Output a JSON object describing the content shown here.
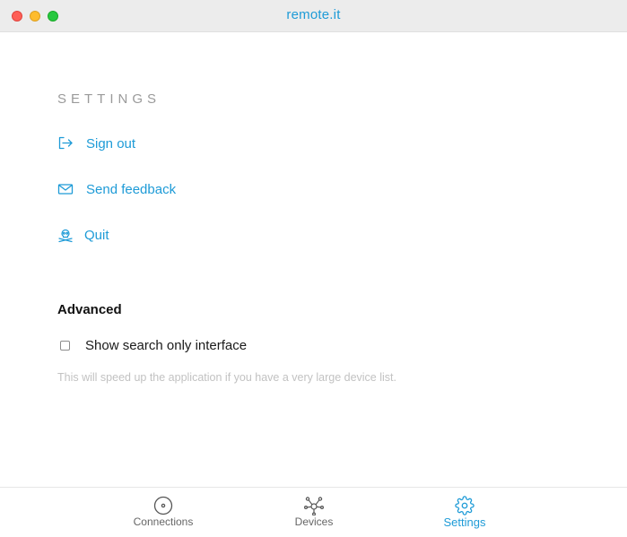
{
  "window": {
    "title": "remote.it"
  },
  "settings": {
    "heading": "SETTINGS",
    "items": [
      {
        "label": "Sign out",
        "icon": "sign-out-icon"
      },
      {
        "label": "Send feedback",
        "icon": "envelope-icon"
      },
      {
        "label": "Quit",
        "icon": "skull-crossbones-icon"
      }
    ]
  },
  "advanced": {
    "heading": "Advanced",
    "search_only": {
      "label": "Show search only interface",
      "checked": false
    },
    "help_text": "This will speed up the application if you have a very large device list."
  },
  "bottom_nav": {
    "items": [
      {
        "label": "Connections",
        "icon": "disc-icon",
        "active": false
      },
      {
        "label": "Devices",
        "icon": "network-nodes-icon",
        "active": false
      },
      {
        "label": "Settings",
        "icon": "gear-icon",
        "active": true
      }
    ]
  },
  "colors": {
    "accent": "#1e9bd7",
    "titlebar": "#ececec",
    "muted_text": "#9a9a9a",
    "help_text": "#c2c2c2"
  }
}
